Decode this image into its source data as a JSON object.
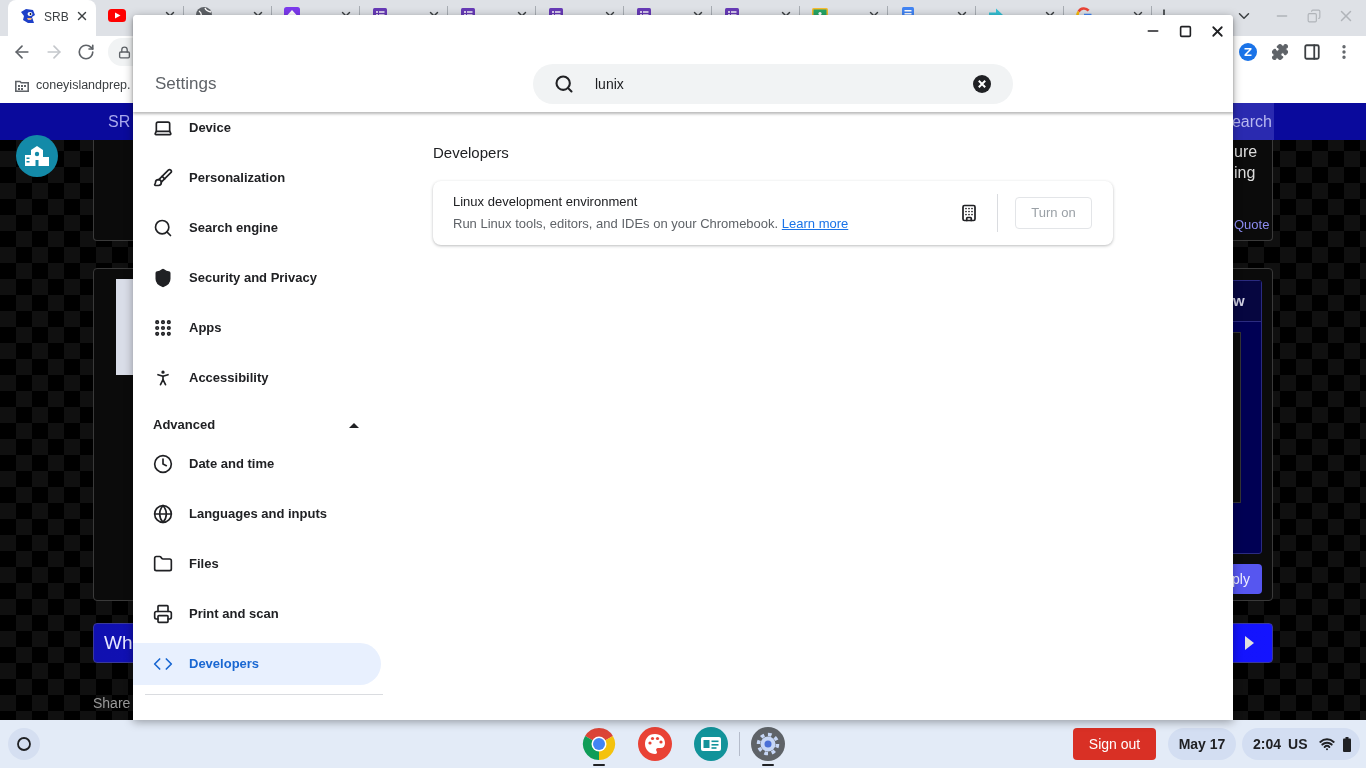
{
  "browser": {
    "tabs": [
      {
        "title": "SRB",
        "kind": "sprite",
        "selected": true
      },
      {
        "kind": "video",
        "selected": false
      },
      {
        "kind": "globe",
        "selected": false
      },
      {
        "kind": "upload",
        "selected": false
      },
      {
        "kind": "form",
        "selected": false
      },
      {
        "kind": "form",
        "selected": false
      },
      {
        "kind": "form",
        "selected": false
      },
      {
        "kind": "form",
        "selected": false
      },
      {
        "kind": "form",
        "selected": false
      },
      {
        "kind": "board",
        "selected": false
      },
      {
        "kind": "doc",
        "selected": false
      },
      {
        "kind": "arrow",
        "selected": false
      },
      {
        "kind": "google",
        "selected": false
      }
    ],
    "bookmarks": [
      {
        "label": "coneyislandprep."
      }
    ],
    "page": {
      "nav_text": "SR",
      "search_button": "earch",
      "card_lines": [
        "ure",
        "ing"
      ],
      "quote_link": "Quote",
      "panel_header": "w",
      "reply_button": "ply",
      "banner_text": "Wh",
      "share_text": "Share"
    }
  },
  "settings": {
    "title": "Settings",
    "search": {
      "value": "lunix"
    },
    "menu": [
      {
        "label": "Device",
        "kind": "laptop",
        "selected": false
      },
      {
        "label": "Personalization",
        "kind": "brush",
        "selected": false
      },
      {
        "label": "Search engine",
        "kind": "search",
        "selected": false
      },
      {
        "label": "Security and Privacy",
        "kind": "shield",
        "selected": false
      },
      {
        "label": "Apps",
        "kind": "grid",
        "selected": false
      },
      {
        "label": "Accessibility",
        "kind": "person",
        "selected": false
      }
    ],
    "advanced": {
      "label": "Advanced",
      "expanded": true,
      "items": [
        {
          "label": "Date and time",
          "kind": "clock",
          "selected": false
        },
        {
          "label": "Languages and inputs",
          "kind": "globe",
          "selected": false
        },
        {
          "label": "Files",
          "kind": "folder",
          "selected": false
        },
        {
          "label": "Print and scan",
          "kind": "printer",
          "selected": false
        },
        {
          "label": "Developers",
          "kind": "code",
          "selected": true
        }
      ]
    },
    "section_title": "Developers",
    "card": {
      "title": "Linux development environment",
      "description": "Run Linux tools, editors, and IDEs on your Chromebook.",
      "link": "Learn more",
      "managed": true,
      "button": {
        "label": "Turn on",
        "disabled": true
      }
    }
  },
  "shelf": {
    "pinned": [
      {
        "kind": "chrome",
        "running": true
      },
      {
        "kind": "palette",
        "running": false
      },
      {
        "kind": "cards",
        "running": false
      }
    ],
    "open": [
      {
        "kind": "settings",
        "running": true
      }
    ],
    "sign_out": "Sign out",
    "date": "May 17",
    "time": "2:04",
    "locale": "US"
  }
}
